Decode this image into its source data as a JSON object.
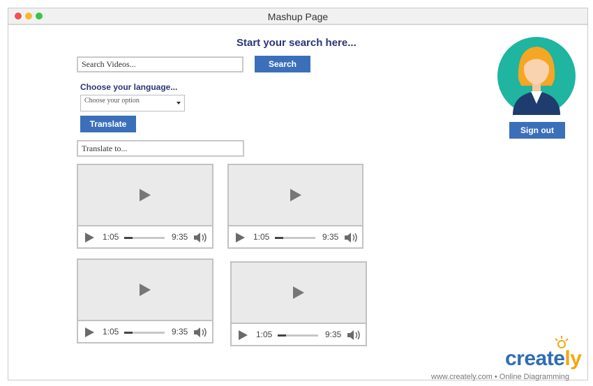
{
  "window": {
    "title": "Mashup Page"
  },
  "main": {
    "heading": "Start your search here...",
    "search": {
      "placeholder": "Search Videos...",
      "button": "Search"
    },
    "language": {
      "label": "Choose your language...",
      "select_value": "Choose your option",
      "translate_button": "Translate",
      "translate_placeholder": "Translate to..."
    }
  },
  "user": {
    "signout": "Sign out"
  },
  "videos": [
    {
      "current": "1:05",
      "duration": "9:35",
      "progress": 0.2
    },
    {
      "current": "1:05",
      "duration": "9:35",
      "progress": 0.2
    },
    {
      "current": "1:05",
      "duration": "9:35",
      "progress": 0.2
    },
    {
      "current": "1:05",
      "duration": "9:35",
      "progress": 0.2
    }
  ],
  "footer": {
    "logo_main": "create",
    "logo_accent": "ly",
    "url": "www.creately.com • Online Diagramming"
  },
  "colors": {
    "accent": "#3c6fba",
    "heading": "#2c3478",
    "avatar_bg": "#1fb5a0"
  }
}
